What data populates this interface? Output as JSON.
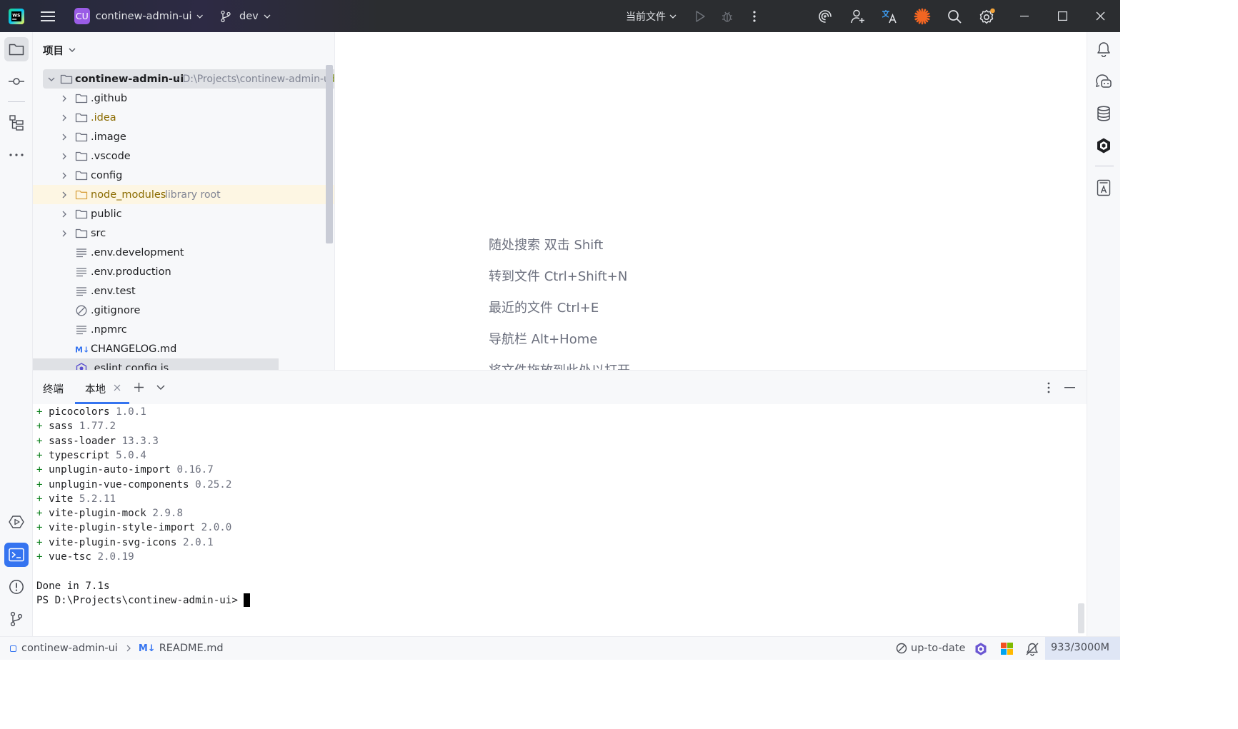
{
  "titlebar": {
    "project_badge": "CU",
    "project_name": "continew-admin-ui",
    "branch": "dev",
    "run_config": "当前文件",
    "colors": {
      "badge": "#9a5ce6",
      "spark": "#f26522",
      "dot": "#f2a33a"
    }
  },
  "left_strip": {
    "icons": [
      "folder-icon",
      "commit-icon",
      "structure-icon",
      "more-icon",
      "run-icon",
      "terminal-icon",
      "problems-icon",
      "git-icon"
    ]
  },
  "right_strip": {
    "icons": [
      "notifications-icon",
      "ai-chat-icon",
      "database-icon",
      "ai-assistant-icon",
      "translate-doc-icon"
    ]
  },
  "project": {
    "header": "项目",
    "root": {
      "name": "continew-admin-ui",
      "path": "- D:\\Projects\\continew-admin-ui",
      "trail": "d"
    },
    "items": [
      {
        "name": ".github",
        "type": "folder"
      },
      {
        "name": ".idea",
        "type": "folder"
      },
      {
        "name": ".image",
        "type": "folder"
      },
      {
        "name": ".vscode",
        "type": "folder"
      },
      {
        "name": "config",
        "type": "folder"
      },
      {
        "name": "node_modules",
        "type": "folder",
        "hint": "library root"
      },
      {
        "name": "public",
        "type": "folder"
      },
      {
        "name": "src",
        "type": "folder"
      },
      {
        "name": ".env.development",
        "type": "text"
      },
      {
        "name": ".env.production",
        "type": "text"
      },
      {
        "name": ".env.test",
        "type": "text"
      },
      {
        "name": ".gitignore",
        "type": "ignore"
      },
      {
        "name": ".npmrc",
        "type": "text"
      },
      {
        "name": "CHANGELOG.md",
        "type": "md"
      },
      {
        "name": ".eslint.config.js",
        "type": "eslint"
      }
    ]
  },
  "editor": {
    "tips": [
      "随处搜索 双击 Shift",
      "转到文件 Ctrl+Shift+N",
      "最近的文件 Ctrl+E",
      "导航栏 Alt+Home",
      "将文件拖放到此处以打开"
    ]
  },
  "terminal": {
    "title": "终端",
    "tab": "本地",
    "lines": [
      {
        "plus": "+ ",
        "pkg": "picocolors",
        "ver": "1.0.1"
      },
      {
        "plus": "+ ",
        "pkg": "sass",
        "ver": "1.77.2"
      },
      {
        "plus": "+ ",
        "pkg": "sass-loader",
        "ver": "13.3.3"
      },
      {
        "plus": "+ ",
        "pkg": "typescript",
        "ver": "5.0.4"
      },
      {
        "plus": "+ ",
        "pkg": "unplugin-auto-import",
        "ver": "0.16.7"
      },
      {
        "plus": "+ ",
        "pkg": "unplugin-vue-components",
        "ver": "0.25.2"
      },
      {
        "plus": "+ ",
        "pkg": "vite",
        "ver": "5.2.11"
      },
      {
        "plus": "+ ",
        "pkg": "vite-plugin-mock",
        "ver": "2.9.8"
      },
      {
        "plus": "+ ",
        "pkg": "vite-plugin-style-import",
        "ver": "2.0.0"
      },
      {
        "plus": "+ ",
        "pkg": "vite-plugin-svg-icons",
        "ver": "2.0.1"
      },
      {
        "plus": "+ ",
        "pkg": "vue-tsc",
        "ver": "2.0.19"
      }
    ],
    "done": "Done in 7.1s",
    "prompt": "PS D:\\Projects\\continew-admin-ui> "
  },
  "status": {
    "crumb_project": "continew-admin-ui",
    "crumb_file_prefix": "M↓",
    "crumb_file": "README.md",
    "vcs": "up-to-date",
    "memory": "933/3000M"
  }
}
